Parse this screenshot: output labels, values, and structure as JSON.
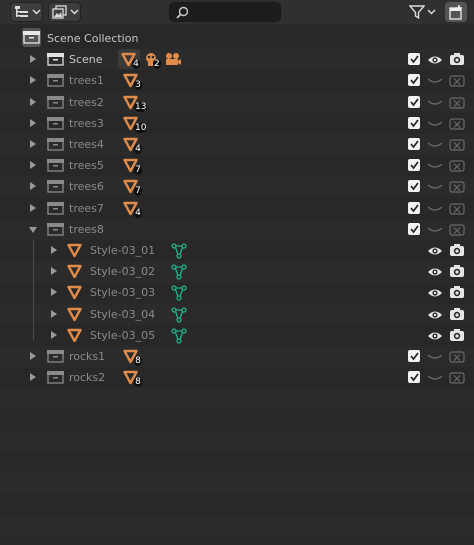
{
  "header": {
    "display_mode_icon": "outliner-view-icon",
    "filter_icon": "filter-funnel-icon",
    "search": {
      "placeholder": "",
      "value": ""
    },
    "new_collection_icon": "new-collection-icon"
  },
  "colors": {
    "background": "#282828",
    "header": "#303030",
    "object_orange": "#e08b4a",
    "style_green": "#1eb38a",
    "disabled_text": "#8a8a8a"
  },
  "root": {
    "label": "Scene Collection"
  },
  "scene_row": {
    "label": "Scene",
    "object_count": "4",
    "other_count": "2"
  },
  "collections": [
    {
      "label": "trees1",
      "count": "3"
    },
    {
      "label": "trees2",
      "count": "13"
    },
    {
      "label": "trees3",
      "count": "10"
    },
    {
      "label": "trees4",
      "count": "4"
    },
    {
      "label": "trees5",
      "count": "7"
    },
    {
      "label": "trees6",
      "count": "7"
    },
    {
      "label": "trees7",
      "count": "4"
    }
  ],
  "expanded": {
    "label": "trees8",
    "children": [
      {
        "label": "Style-03_01"
      },
      {
        "label": "Style-03_02"
      },
      {
        "label": "Style-03_03"
      },
      {
        "label": "Style-03_04"
      },
      {
        "label": "Style-03_05"
      }
    ]
  },
  "after": [
    {
      "label": "rocks1",
      "count": "8"
    },
    {
      "label": "rocks2",
      "count": "8"
    }
  ]
}
